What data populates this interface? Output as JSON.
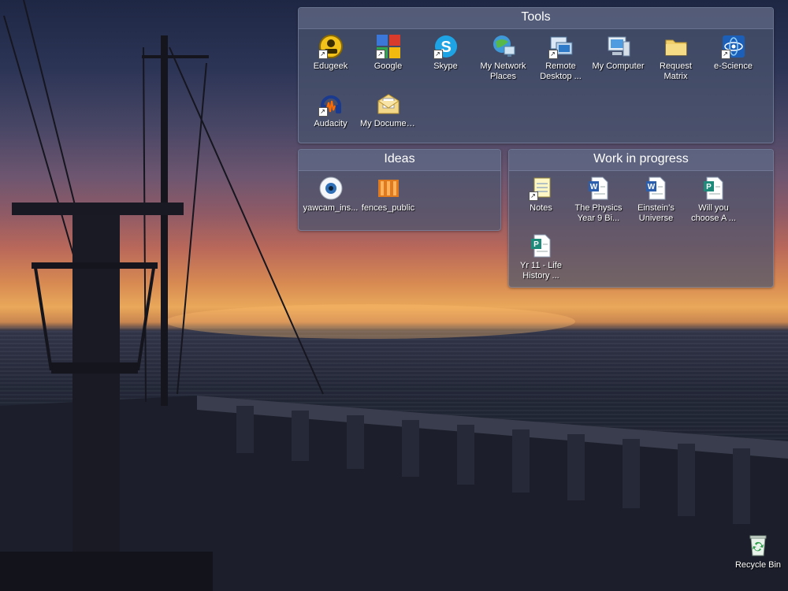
{
  "fences": {
    "tools": {
      "title": "Tools",
      "items": [
        {
          "label": "Edugeek",
          "icon": "edugeek-icon"
        },
        {
          "label": "Google",
          "icon": "google-icon"
        },
        {
          "label": "Skype",
          "icon": "skype-icon"
        },
        {
          "label": "My Network Places",
          "icon": "network-places-icon"
        },
        {
          "label": "Remote Desktop ...",
          "icon": "remote-desktop-icon"
        },
        {
          "label": "My Computer",
          "icon": "my-computer-icon"
        },
        {
          "label": "Request Matrix",
          "icon": "folder-icon"
        },
        {
          "label": "e-Science",
          "icon": "e-science-icon"
        },
        {
          "label": "Audacity",
          "icon": "audacity-icon"
        },
        {
          "label": "My Documents",
          "icon": "my-documents-icon"
        }
      ]
    },
    "ideas": {
      "title": "Ideas",
      "items": [
        {
          "label": "yawcam_ins...",
          "icon": "yawcam-icon"
        },
        {
          "label": "fences_public",
          "icon": "fences-icon"
        }
      ]
    },
    "wip": {
      "title": "Work in progress",
      "items": [
        {
          "label": "Notes",
          "icon": "notes-icon"
        },
        {
          "label": "The Physics Year 9 Bi...",
          "icon": "word-document-icon"
        },
        {
          "label": "Einstein's Universe",
          "icon": "word-document-icon"
        },
        {
          "label": "Will you choose A ...",
          "icon": "publisher-document-icon"
        },
        {
          "label": "Yr 11 - Life History ...",
          "icon": "publisher-document-icon"
        }
      ]
    }
  },
  "desktop": {
    "recycle_bin": "Recycle Bin"
  }
}
